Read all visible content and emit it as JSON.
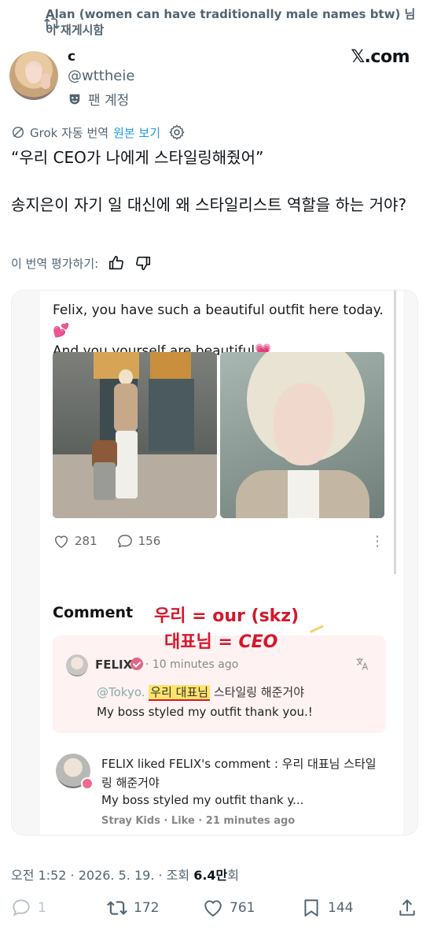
{
  "repost": {
    "label": "Alan (women can have traditionally male names btw) 님이 재게시함"
  },
  "author": {
    "display_name": "c",
    "handle": "@wttheie",
    "account_type": "팬 계정"
  },
  "brand": "𝕏.com",
  "translation": {
    "source": "Grok 자동 번역",
    "view_original": "원본 보기",
    "rate_label": "이 번역 평가하기:"
  },
  "tweet": {
    "text": "“우리 CEO가 나에게 스타일링해줬어”\n\n송지은이 자기 일 대신에 왜 스타일리스트 역할을 하는 거야?"
  },
  "embedded": {
    "caption_line1": "Felix, you have such a beautiful outfit here today.💕",
    "caption_line2": "And you yourself are beautiful💗",
    "likes": "281",
    "comments": "156",
    "comment_heading": "Comment",
    "annotation_line1": "우리 = our (skz)",
    "annotation_line2_ko": "대표님 = ",
    "annotation_line2_en": "CEO",
    "comment": {
      "name": "FELIX",
      "time": "· 10 minutes ago",
      "mention": "@Tokyo.",
      "highlight": "우리 대표님",
      "rest": " 스타일링 해준거야",
      "translation": "My boss styled my outfit thank you.!"
    },
    "notification": {
      "line1": "FELIX liked FELIX's comment : 우리 대표님 스타일링 해준거야",
      "line2": "My boss styled my outfit thank y...",
      "meta": "Stray Kids · Like · 21 minutes ago"
    }
  },
  "meta": {
    "timestamp": "오전 1:52 · 2026. 5. 19. · 조회 ",
    "views": "6.4만",
    "views_suffix": "회"
  },
  "actions": {
    "replies": "1",
    "reposts": "172",
    "likes": "761",
    "bookmarks": "144"
  }
}
